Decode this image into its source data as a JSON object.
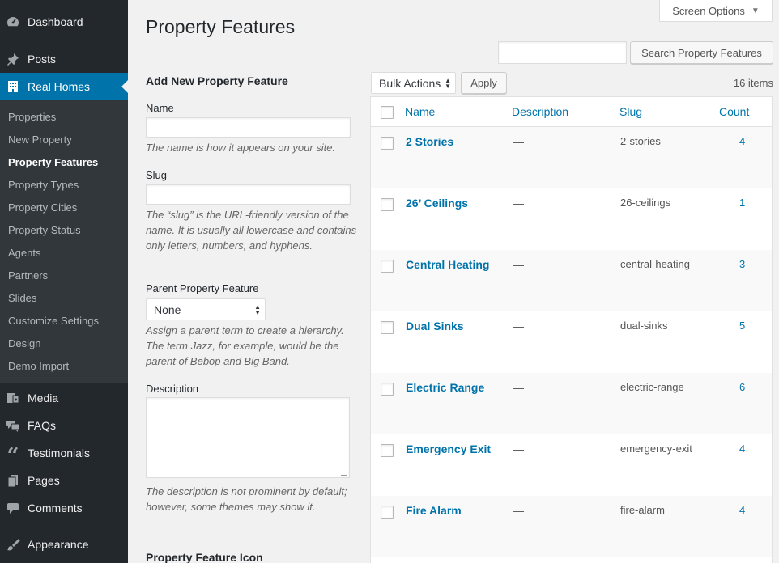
{
  "sidebar": {
    "dashboard": "Dashboard",
    "posts": "Posts",
    "real_homes": "Real Homes",
    "submenu": [
      "Properties",
      "New Property",
      "Property Features",
      "Property Types",
      "Property Cities",
      "Property Status",
      "Agents",
      "Partners",
      "Slides",
      "Customize Settings",
      "Design",
      "Demo Import"
    ],
    "media": "Media",
    "faqs": "FAQs",
    "testimonials": "Testimonials",
    "pages": "Pages",
    "comments": "Comments",
    "appearance": "Appearance"
  },
  "header": {
    "screen_options": "Screen Options",
    "page_title": "Property Features",
    "search_button": "Search Property Features"
  },
  "form": {
    "heading": "Add New Property Feature",
    "name_label": "Name",
    "name_help": "The name is how it appears on your site.",
    "slug_label": "Slug",
    "slug_help": "The “slug” is the URL-friendly version of the name. It is usually all lowercase and contains only letters, numbers, and hyphens.",
    "parent_label": "Parent Property Feature",
    "parent_value": "None",
    "parent_help": "Assign a parent term to create a hierarchy. The term Jazz, for example, would be the parent of Bebop and Big Band.",
    "description_label": "Description",
    "description_help": "The description is not prominent by default; however, some themes may show it.",
    "icon_heading": "Property Feature Icon"
  },
  "table": {
    "bulk_actions": "Bulk Actions",
    "apply": "Apply",
    "items_count": "16 items",
    "columns": {
      "name": "Name",
      "description": "Description",
      "slug": "Slug",
      "count": "Count"
    },
    "rows": [
      {
        "name": "2 Stories",
        "description": "—",
        "slug": "2-stories",
        "count": "4"
      },
      {
        "name": "26’ Ceilings",
        "description": "—",
        "slug": "26-ceilings",
        "count": "1"
      },
      {
        "name": "Central Heating",
        "description": "—",
        "slug": "central-heating",
        "count": "3"
      },
      {
        "name": "Dual Sinks",
        "description": "—",
        "slug": "dual-sinks",
        "count": "5"
      },
      {
        "name": "Electric Range",
        "description": "—",
        "slug": "electric-range",
        "count": "6"
      },
      {
        "name": "Emergency Exit",
        "description": "—",
        "slug": "emergency-exit",
        "count": "4"
      },
      {
        "name": "Fire Alarm",
        "description": "—",
        "slug": "fire-alarm",
        "count": "4"
      }
    ]
  },
  "colors": {
    "sidebar_bg": "#23282d",
    "submenu_bg": "#32373c",
    "accent": "#0073aa",
    "page_bg": "#f1f1f1"
  }
}
